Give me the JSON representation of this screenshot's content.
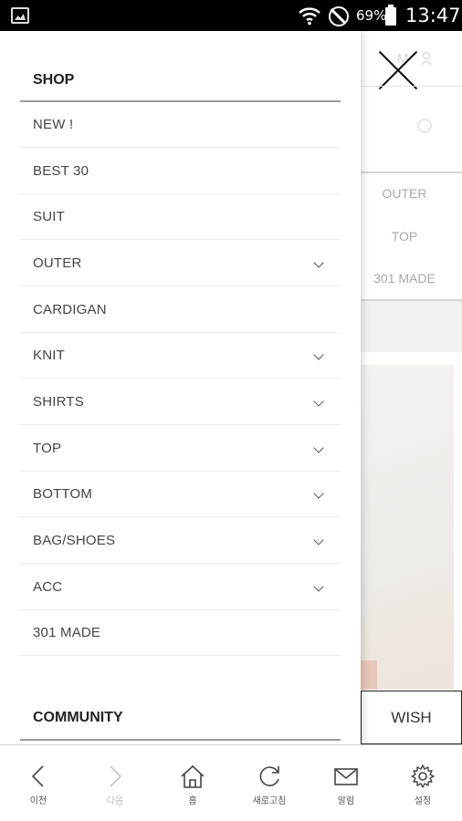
{
  "status_bar": {
    "battery_percent": "69%",
    "time": "13:47",
    "icons": [
      "gallery-icon",
      "wifi-icon",
      "do-not-disturb-icon",
      "battery-icon"
    ]
  },
  "background_page": {
    "categories": [
      "OUTER",
      "TOP",
      "301 MADE"
    ],
    "wish_label": "WISH",
    "partial_text": "M"
  },
  "drawer": {
    "shop_title": "SHOP",
    "shop_items": [
      {
        "label": "NEW !",
        "expandable": false
      },
      {
        "label": "BEST 30",
        "expandable": false
      },
      {
        "label": "SUIT",
        "expandable": false
      },
      {
        "label": "OUTER",
        "expandable": true
      },
      {
        "label": "CARDIGAN",
        "expandable": false
      },
      {
        "label": "KNIT",
        "expandable": true
      },
      {
        "label": "SHIRTS",
        "expandable": true
      },
      {
        "label": "TOP",
        "expandable": true
      },
      {
        "label": "BOTTOM",
        "expandable": true
      },
      {
        "label": "BAG/SHOES",
        "expandable": true
      },
      {
        "label": "ACC",
        "expandable": true
      },
      {
        "label": "301 MADE",
        "expandable": false
      }
    ],
    "community_title": "COMMUNITY"
  },
  "bottom_nav": {
    "items": [
      {
        "label": "이전",
        "icon": "back-icon",
        "enabled": true
      },
      {
        "label": "다음",
        "icon": "forward-icon",
        "enabled": false
      },
      {
        "label": "홈",
        "icon": "home-icon",
        "enabled": true
      },
      {
        "label": "새로고침",
        "icon": "refresh-icon",
        "enabled": true
      },
      {
        "label": "알림",
        "icon": "mail-icon",
        "enabled": true
      },
      {
        "label": "설정",
        "icon": "gear-icon",
        "enabled": true
      }
    ]
  }
}
